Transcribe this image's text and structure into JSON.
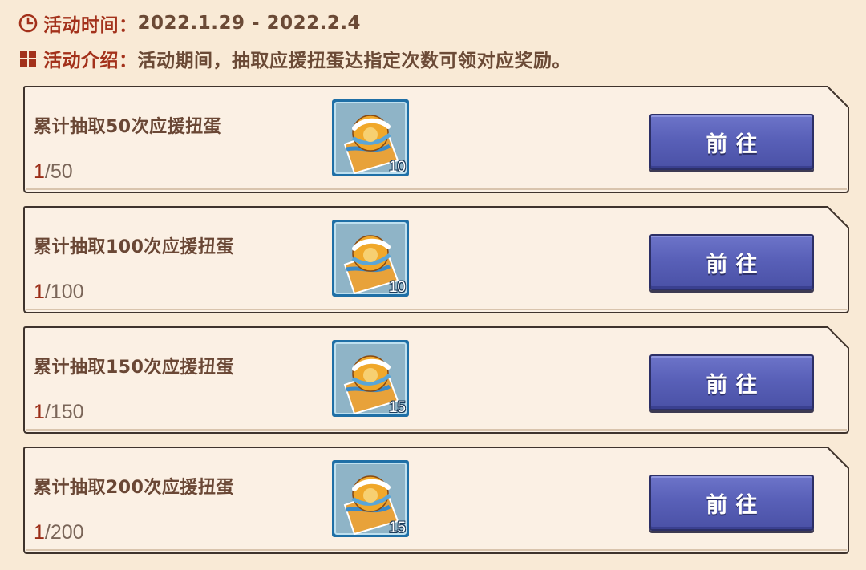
{
  "event": {
    "time_label": "活动时间：",
    "time_value": "2022.1.29 - 2022.2.4",
    "intro_label": "活动介绍：",
    "intro_value": "活动期间，抽取应援扭蛋达指定次数可领对应奖励。",
    "time_icon": "clock-icon",
    "intro_icon": "grid-icon"
  },
  "colors": {
    "label_red": "#a3311b",
    "text_brown": "#6b4a36",
    "button_blue": "#5960b8",
    "card_bg": "#fbf0e4",
    "page_bg": "#f9ead6"
  },
  "tasks": [
    {
      "title": "累计抽取50次应援扭蛋",
      "progress_current": "1",
      "progress_total": "/50",
      "reward_icon": "gacha-ticket-icon",
      "reward_count": "10",
      "button_label": "前往"
    },
    {
      "title": "累计抽取100次应援扭蛋",
      "progress_current": "1",
      "progress_total": "/100",
      "reward_icon": "gacha-ticket-icon",
      "reward_count": "10",
      "button_label": "前往"
    },
    {
      "title": "累计抽取150次应援扭蛋",
      "progress_current": "1",
      "progress_total": "/150",
      "reward_icon": "gacha-ticket-icon",
      "reward_count": "15",
      "button_label": "前往"
    },
    {
      "title": "累计抽取200次应援扭蛋",
      "progress_current": "1",
      "progress_total": "/200",
      "reward_icon": "gacha-ticket-icon",
      "reward_count": "15",
      "button_label": "前往"
    }
  ]
}
